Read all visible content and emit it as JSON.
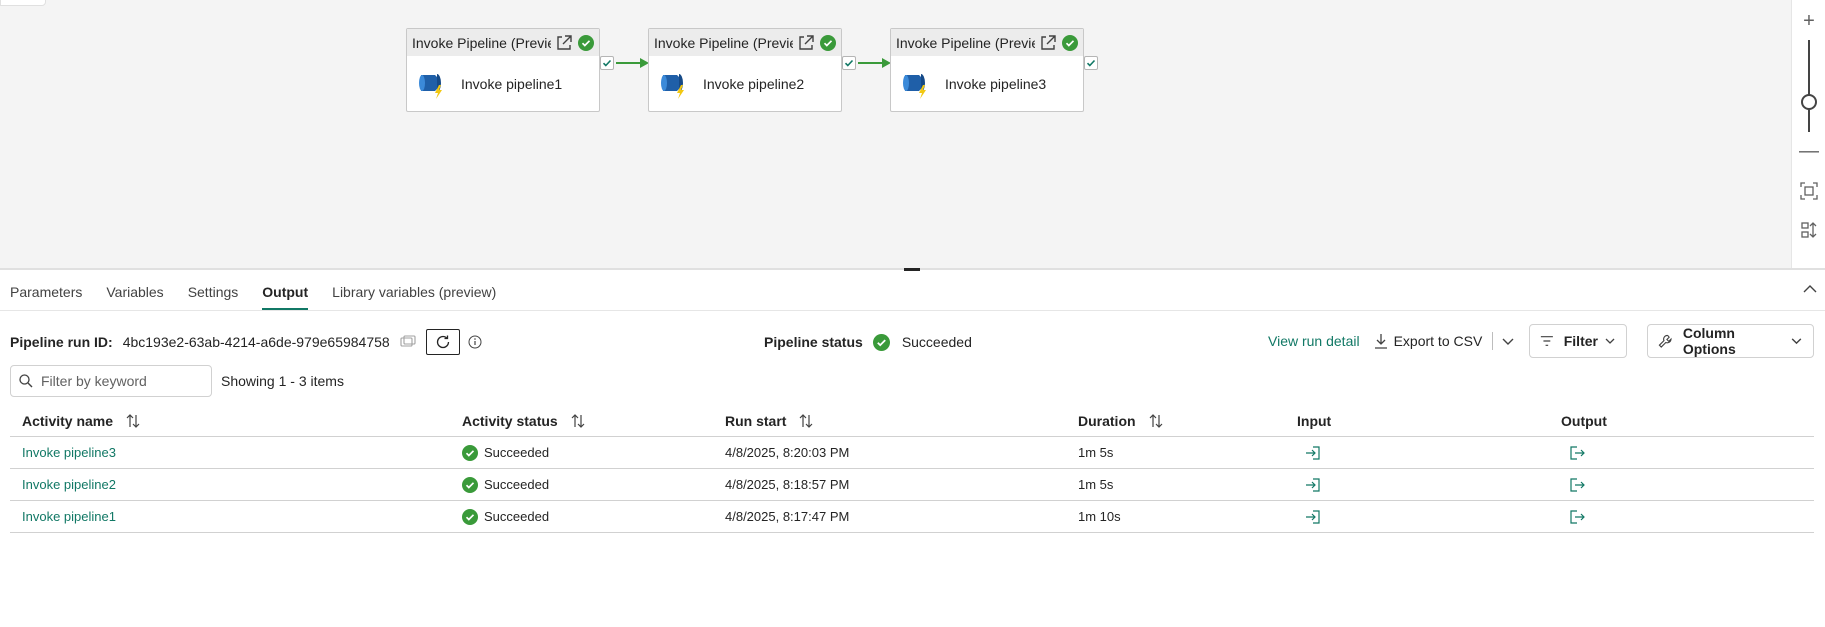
{
  "canvas": {
    "nodes": [
      {
        "header": "Invoke Pipeline (Previe",
        "name": "Invoke pipeline1"
      },
      {
        "header": "Invoke Pipeline (Previe",
        "name": "Invoke pipeline2"
      },
      {
        "header": "Invoke Pipeline (Previe",
        "name": "Invoke pipeline3"
      }
    ],
    "zoom": {
      "zoom_in": "+",
      "zoom_out": "—"
    }
  },
  "tabs": [
    "Parameters",
    "Variables",
    "Settings",
    "Output",
    "Library variables (preview)"
  ],
  "active_tab": "Output",
  "run": {
    "id_label": "Pipeline run ID:",
    "id_value": "4bc193e2-63ab-4214-a6de-979e65984758",
    "status_label": "Pipeline status",
    "status_value": "Succeeded"
  },
  "actions": {
    "view_run_detail": "View run detail",
    "export_csv": "Export to CSV",
    "filter": "Filter",
    "column_options": "Column Options"
  },
  "search": {
    "placeholder": "Filter by keyword"
  },
  "showing": "Showing 1 - 3 items",
  "table": {
    "headers": [
      "Activity name",
      "Activity status",
      "Run start",
      "Duration",
      "Input",
      "Output"
    ],
    "rows": [
      {
        "name": "Invoke pipeline3",
        "status": "Succeeded",
        "run_start": "4/8/2025, 8:20:03 PM",
        "duration": "1m 5s"
      },
      {
        "name": "Invoke pipeline2",
        "status": "Succeeded",
        "run_start": "4/8/2025, 8:18:57 PM",
        "duration": "1m 5s"
      },
      {
        "name": "Invoke pipeline1",
        "status": "Succeeded",
        "run_start": "4/8/2025, 8:17:47 PM",
        "duration": "1m 10s"
      }
    ]
  },
  "colors": {
    "accent": "#117865",
    "success": "#3a9a3a"
  }
}
